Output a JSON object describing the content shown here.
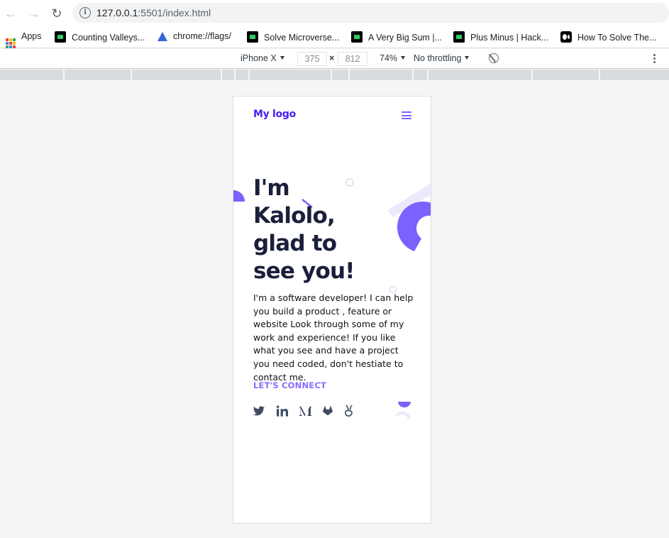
{
  "browser": {
    "url_host": "127.0.0.1",
    "url_rest": ":5501/index.html"
  },
  "bookmarks": [
    {
      "label": "Apps",
      "icon": "apps-grid-icon"
    },
    {
      "label": "Counting Valleys...",
      "icon": "hackerrank-icon"
    },
    {
      "label": "chrome://flags/",
      "icon": "flask-icon"
    },
    {
      "label": "Solve Microverse...",
      "icon": "hackerrank-icon"
    },
    {
      "label": "A Very Big Sum |...",
      "icon": "hackerrank-icon"
    },
    {
      "label": "Plus Minus | Hack...",
      "icon": "hackerrank-icon"
    },
    {
      "label": "How To Solve The...",
      "icon": "medium-icon"
    }
  ],
  "devtools": {
    "device": "iPhone X",
    "width": "375",
    "height": "812",
    "times": "×",
    "zoom": "74%",
    "throttling": "No throttling"
  },
  "site": {
    "logo": "My logo",
    "hero_lines": [
      "I'm",
      "Kalolo,",
      "glad to",
      "see you!"
    ],
    "intro": "I'm a software developer! I can help you build a product , feature or website Look through some of my work and experience! If you like what you see and have a project you need coded, don't hestiate to contact me.",
    "cta": "LET'S CONNECT",
    "socials": [
      "twitter-icon",
      "linkedin-icon",
      "medium-icon",
      "gitlab-icon",
      "angellist-icon"
    ],
    "accent": "#7b61ff",
    "heading_color": "#1a1f3c"
  }
}
